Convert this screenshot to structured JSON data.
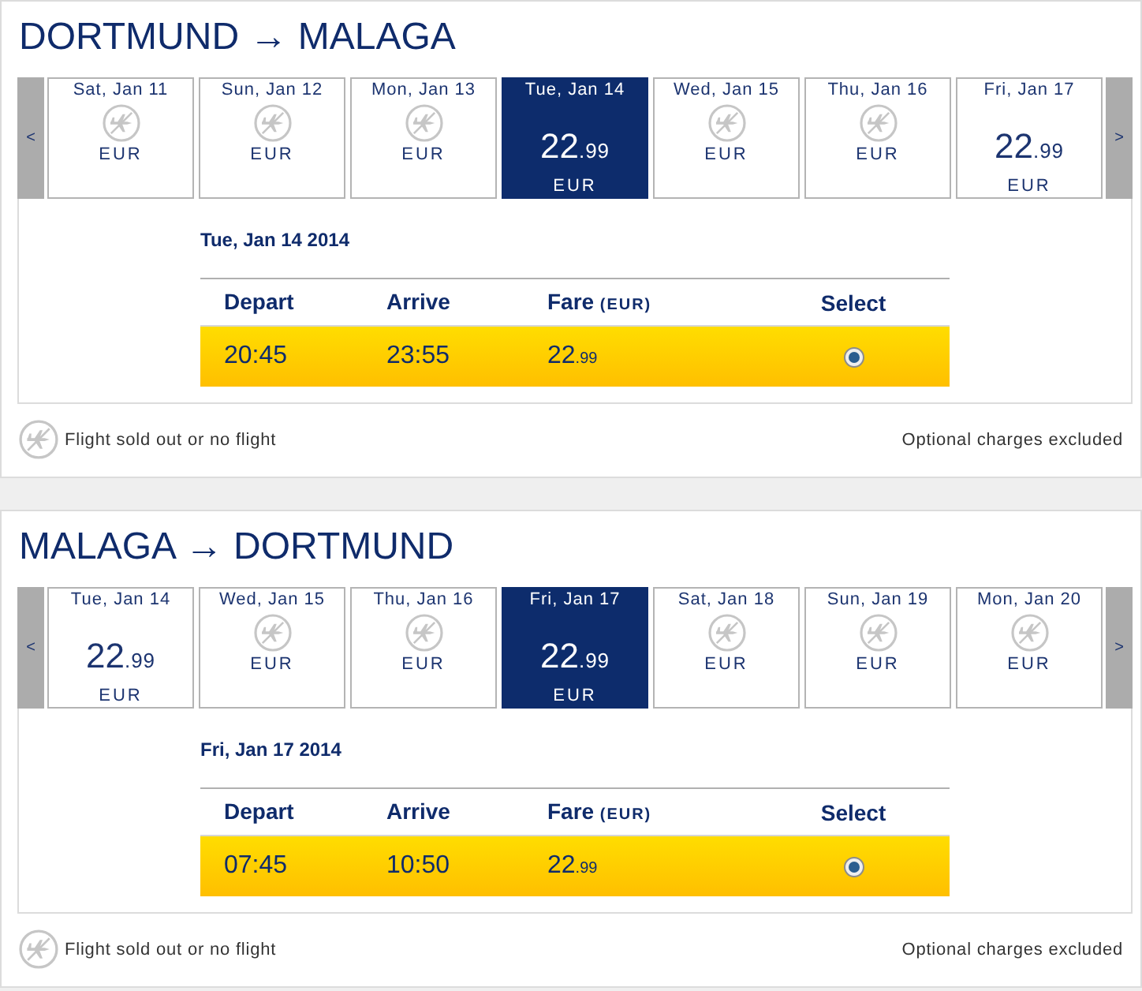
{
  "journeys": [
    {
      "title": "DORTMUND → MALAGA",
      "prev_button": "<",
      "next_button": ">",
      "dates": [
        {
          "kind": "sold_out",
          "day": "Sat, Jan 11",
          "currency": "EUR",
          "selected": false
        },
        {
          "kind": "sold_out",
          "day": "Sun, Jan 12",
          "currency": "EUR",
          "selected": false
        },
        {
          "kind": "sold_out",
          "day": "Mon, Jan 13",
          "currency": "EUR",
          "selected": false
        },
        {
          "kind": "fare",
          "day": "Tue, Jan 14",
          "price": "22",
          "cents": ".99",
          "currency": "EUR",
          "selected": true
        },
        {
          "kind": "sold_out",
          "day": "Wed, Jan 15",
          "currency": "EUR",
          "selected": false
        },
        {
          "kind": "sold_out",
          "day": "Thu, Jan 16",
          "currency": "EUR",
          "selected": false
        },
        {
          "kind": "fare",
          "day": "Fri, Jan 17",
          "price": "22",
          "cents": ".99",
          "currency": "EUR",
          "selected": false
        }
      ],
      "selected_date": "Tue, Jan 14 2014",
      "columns": [
        {
          "label": "Depart"
        },
        {
          "label": "Arrive"
        },
        {
          "label": "Fare",
          "unit": "(EUR)"
        },
        {
          "label": "Select"
        }
      ],
      "flights": [
        {
          "depart": "20:45",
          "arrive": "23:55",
          "fare": "22",
          "cents": ".99",
          "selected": true
        }
      ],
      "legend": "Flight sold out or no flight",
      "note": "Optional charges excluded"
    },
    {
      "title": "MALAGA → DORTMUND",
      "prev_button": "<",
      "next_button": ">",
      "dates": [
        {
          "kind": "fare",
          "day": "Tue, Jan 14",
          "price": "22",
          "cents": ".99",
          "currency": "EUR",
          "selected": false
        },
        {
          "kind": "sold_out",
          "day": "Wed, Jan 15",
          "currency": "EUR",
          "selected": false
        },
        {
          "kind": "sold_out",
          "day": "Thu, Jan 16",
          "currency": "EUR",
          "selected": false
        },
        {
          "kind": "fare",
          "day": "Fri, Jan 17",
          "price": "22",
          "cents": ".99",
          "currency": "EUR",
          "selected": true
        },
        {
          "kind": "sold_out",
          "day": "Sat, Jan 18",
          "currency": "EUR",
          "selected": false
        },
        {
          "kind": "sold_out",
          "day": "Sun, Jan 19",
          "currency": "EUR",
          "selected": false
        },
        {
          "kind": "sold_out",
          "day": "Mon, Jan 20",
          "currency": "EUR",
          "selected": false
        }
      ],
      "selected_date": "Fri, Jan 17 2014",
      "columns": [
        {
          "label": "Depart"
        },
        {
          "label": "Arrive"
        },
        {
          "label": "Fare",
          "unit": "(EUR)"
        },
        {
          "label": "Select"
        }
      ],
      "flights": [
        {
          "depart": "07:45",
          "arrive": "10:50",
          "fare": "22",
          "cents": ".99",
          "selected": true
        }
      ],
      "legend": "Flight sold out or no flight",
      "note": "Optional charges excluded"
    }
  ]
}
